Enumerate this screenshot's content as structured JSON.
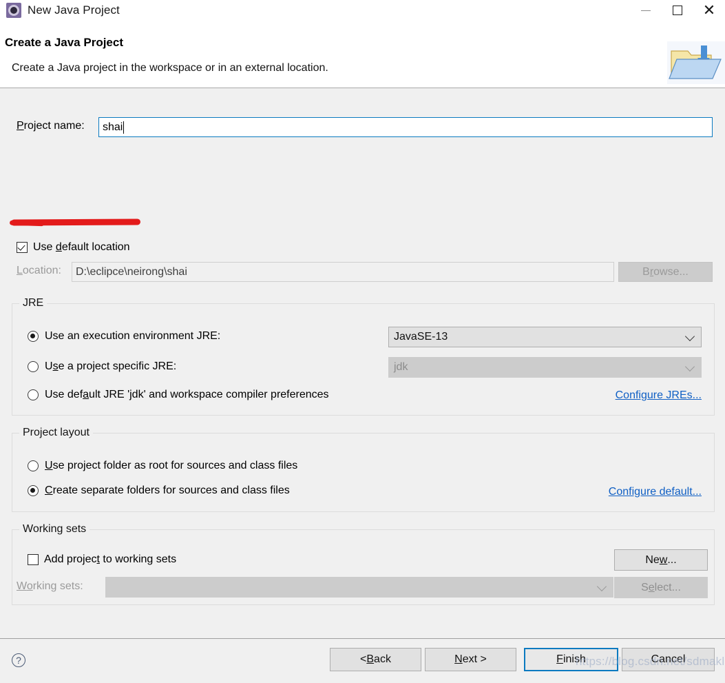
{
  "window": {
    "title": "New Java Project",
    "icon": "eclipse-wizard-icon",
    "controls": {
      "minimize": "—",
      "maximize": "□",
      "close": "✕"
    }
  },
  "header": {
    "title": "Create a Java Project",
    "description": "Create a Java project in the workspace or in an external location.",
    "banner_icon": "java-project-folder-icon"
  },
  "project_name": {
    "label_prefix": "P",
    "label_rest": "roject name:",
    "value": "shai"
  },
  "use_default_location": {
    "checked": true,
    "label_before": "Use ",
    "label_mnemonic": "d",
    "label_after": "efault location"
  },
  "location": {
    "label_mnemonic": "L",
    "label_rest": "ocation:",
    "value": "D:\\eclipce\\neirong\\shai",
    "browse_before": "B",
    "browse_mnemonic": "r",
    "browse_after": "owse...",
    "enabled": false
  },
  "jre": {
    "group_title": "JRE",
    "options": [
      {
        "before": "Use an en",
        "mnemonic": "v",
        "after": "ironment JRE:",
        "full": "Use an execution environment JRE:",
        "selected": true
      },
      {
        "before": "U",
        "mnemonic": "s",
        "after": "e a project specific JRE:",
        "selected": false
      },
      {
        "before": "Use def",
        "mnemonic": "a",
        "after": "ult JRE 'jdk' and workspace compiler preferences",
        "selected": false
      }
    ],
    "execution_env_value": "JavaSE-13",
    "project_jre_value": "jdk",
    "configure_link": "Configure JREs..."
  },
  "project_layout": {
    "group_title": "Project layout",
    "options": [
      {
        "mnemonic": "U",
        "rest": "se project folder as root for sources and class files",
        "selected": false
      },
      {
        "mnemonic": "C",
        "rest": "reate separate folders for sources and class files",
        "selected": true
      }
    ],
    "configure_link": "Configure default..."
  },
  "working_sets": {
    "group_title": "Working sets",
    "add_checkbox": {
      "checked": false,
      "before": "Add projec",
      "mnemonic": "t",
      "after": " to working sets"
    },
    "label_before": "W",
    "label_mnemonic": "o",
    "label_after": "rking sets:",
    "value": "",
    "new_button": {
      "before": "Ne",
      "mnemonic": "w",
      "after": "...",
      "enabled": true
    },
    "select_button": {
      "before": "S",
      "mnemonic": "e",
      "after": "lect...",
      "enabled": false
    }
  },
  "footer": {
    "help_icon": "?",
    "buttons": [
      {
        "before": "< ",
        "mnemonic": "B",
        "after": "ack",
        "default": false
      },
      {
        "before": "",
        "mnemonic": "N",
        "after": "ext >",
        "default": false
      },
      {
        "before": "",
        "mnemonic": "F",
        "after": "inish",
        "default": true
      },
      {
        "before": "",
        "mnemonic": "",
        "after": "Cancel",
        "default": false
      }
    ]
  },
  "annotation": {
    "type": "red-underline",
    "color": "#e31b1b",
    "target": "project-name-label"
  },
  "watermark": "https://blog.csdn.net/sdmakl",
  "colors": {
    "dialog_bg": "#f0f0f0",
    "header_bg": "#ffffff",
    "focus_border": "#0a7ac0",
    "link": "#0f5fc4",
    "annotation_red": "#e31b1b"
  }
}
